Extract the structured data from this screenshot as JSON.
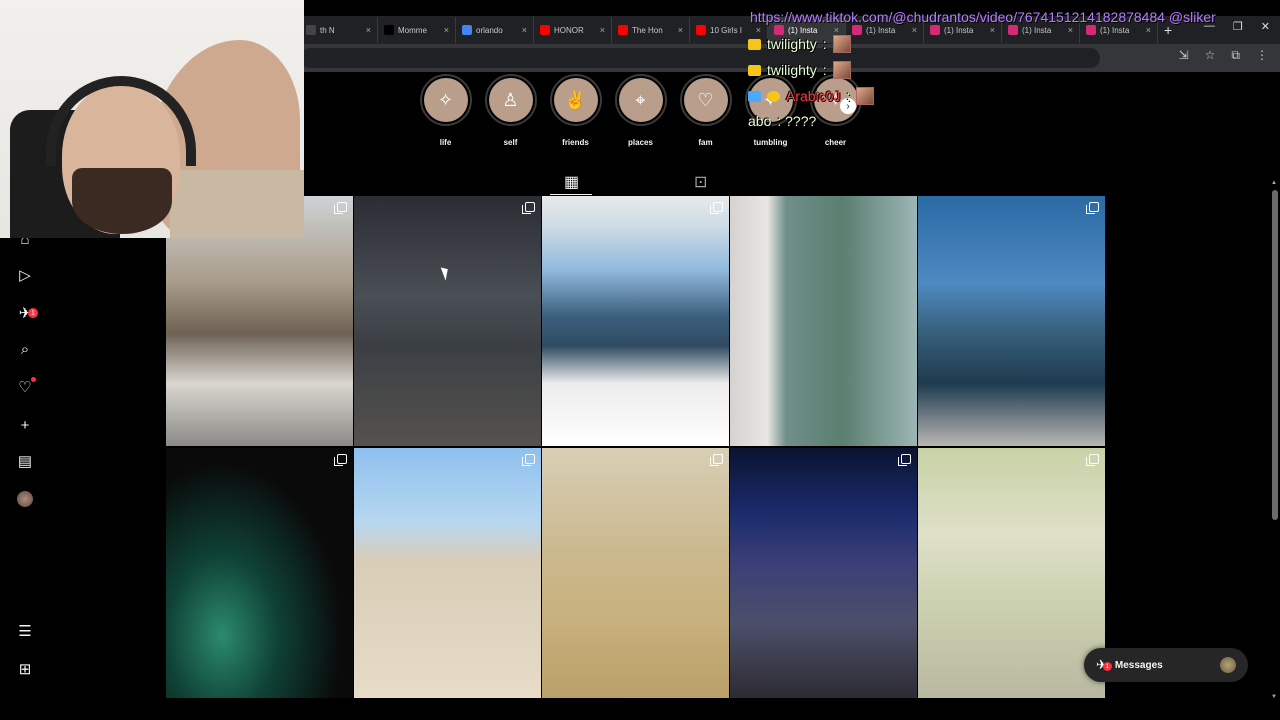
{
  "browser": {
    "tabs": [
      {
        "label": "th N",
        "favicon": "tab-icon",
        "color": "#444"
      },
      {
        "label": "Momme",
        "favicon": "x-icon",
        "color": "#000"
      },
      {
        "label": "orlando",
        "favicon": "google-icon",
        "color": "#4285f4"
      },
      {
        "label": "HONOR",
        "favicon": "youtube-icon",
        "color": "#ff0000"
      },
      {
        "label": "The Hon",
        "favicon": "youtube-icon",
        "color": "#ff0000"
      },
      {
        "label": "10 Girls I",
        "favicon": "youtube-icon",
        "color": "#ff0000"
      },
      {
        "label": "(1) Insta",
        "favicon": "instagram-icon",
        "color": "#d62976"
      },
      {
        "label": "(1) Insta",
        "favicon": "instagram-icon",
        "color": "#d62976"
      },
      {
        "label": "(1) Insta",
        "favicon": "instagram-icon",
        "color": "#d62976"
      },
      {
        "label": "(1) Insta",
        "favicon": "instagram-icon",
        "color": "#d62976"
      },
      {
        "label": "(1) Insta",
        "favicon": "instagram-icon",
        "color": "#d62976"
      }
    ],
    "close_glyph": "×",
    "new_tab_glyph": "+"
  },
  "highlights": [
    {
      "label": "life",
      "icon": "sparkle-icon",
      "glyph": "✧"
    },
    {
      "label": "self",
      "icon": "person-icon",
      "glyph": "♙"
    },
    {
      "label": "friends",
      "icon": "fingers-crossed-icon",
      "glyph": "✌"
    },
    {
      "label": "places",
      "icon": "location-pin-icon",
      "glyph": "⌖"
    },
    {
      "label": "fam",
      "icon": "heart-icon",
      "glyph": "♡"
    },
    {
      "label": "tumbling",
      "icon": "gymnast-icon",
      "glyph": "✦"
    },
    {
      "label": "cheer",
      "icon": "cheer-icon",
      "glyph": "✧"
    }
  ],
  "profile_tabs": {
    "posts_icon": "▦",
    "tagged_icon": "⊡"
  },
  "posts": [
    {
      "multi": true
    },
    {
      "multi": true
    },
    {
      "multi": true
    },
    {
      "multi": false
    },
    {
      "multi": true
    },
    {
      "multi": true
    },
    {
      "multi": true
    },
    {
      "multi": true
    },
    {
      "multi": true
    },
    {
      "multi": true
    }
  ],
  "sidebar": {
    "notifications_badge": "1"
  },
  "messages": {
    "label": "Messages",
    "badge": "1"
  },
  "stream_overlay": {
    "url_line": "https://www.tiktok.com/@chudrantos/video/7674151214182878484 @sliker",
    "chat": [
      {
        "name": "twilighty",
        "text": ":"
      },
      {
        "name": "twilighty",
        "text": ":"
      },
      {
        "name": "Arabic0J",
        "text": ":"
      },
      {
        "name": "abo",
        "text": ": ????"
      }
    ]
  },
  "colors": {
    "background": "#000000",
    "highlight_fill": "#b99f8b",
    "badge_red": "#ff3040",
    "chat_url": "#b47cff"
  }
}
